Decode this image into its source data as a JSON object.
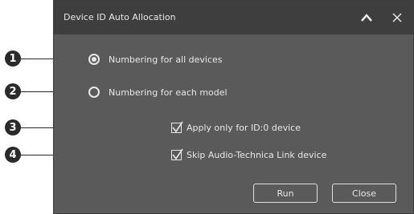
{
  "dialog": {
    "title": "Device ID Auto Allocation",
    "collapse_icon": "chevron-up-icon",
    "close_icon": "close-icon"
  },
  "options": {
    "radio_all": {
      "label": "Numbering for all devices",
      "selected": true
    },
    "radio_each": {
      "label": "Numbering for each model",
      "selected": false
    },
    "check_id0": {
      "label": "Apply only for ID:0 device",
      "checked": true
    },
    "check_skip": {
      "label": "Skip Audio-Technica Link device",
      "checked": true
    }
  },
  "buttons": {
    "run": "Run",
    "close": "Close"
  },
  "callouts": [
    "1",
    "2",
    "3",
    "4"
  ],
  "colors": {
    "dialog_bg": "#5a5a5a",
    "titlebar_bg": "#3e3e3e",
    "text": "#e8e8e8",
    "callout_bg": "#2a2a2a"
  }
}
